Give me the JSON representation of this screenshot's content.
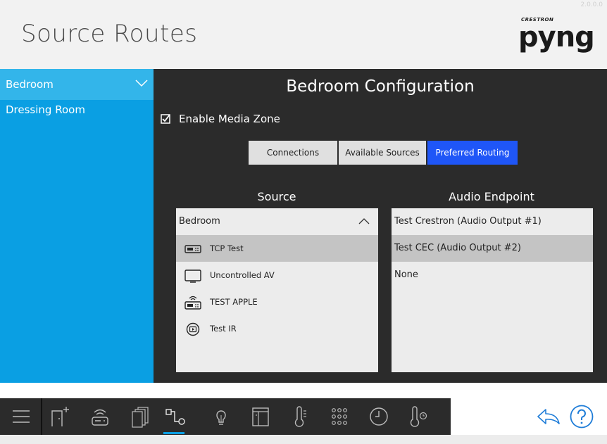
{
  "header": {
    "title": "Source Routes",
    "corner_text": "2.0.0.0"
  },
  "logo": {
    "brand": "CRESTRON",
    "word": "pyng"
  },
  "sidebar": {
    "items": [
      {
        "label": "Bedroom",
        "selected": true
      },
      {
        "label": "Dressing Room",
        "selected": false
      }
    ]
  },
  "main": {
    "title": "Bedroom Configuration",
    "enable_label": "Enable Media Zone",
    "enable_checked": true,
    "tabs": [
      {
        "label": "Connections",
        "active": false
      },
      {
        "label": "Available Sources",
        "active": false
      },
      {
        "label": "Preferred Routing",
        "active": true
      }
    ],
    "source_header": "Source",
    "endpoint_header": "Audio Endpoint",
    "source_room": "Bedroom",
    "sources": [
      {
        "label": "TCP Test",
        "icon": "set-top-box-icon",
        "selected": true
      },
      {
        "label": "Uncontrolled AV",
        "icon": "tv-icon",
        "selected": false
      },
      {
        "label": "TEST APPLE",
        "icon": "wireless-set-top-box-icon",
        "selected": false
      },
      {
        "label": "Test IR",
        "icon": "ir-player-icon",
        "selected": false
      }
    ],
    "endpoints": [
      {
        "label": "Test Crestron (Audio Output #1)",
        "selected": false
      },
      {
        "label": "Test CEC (Audio Output #2)",
        "selected": true
      },
      {
        "label": "None",
        "selected": false
      }
    ]
  },
  "colors": {
    "accent": "#0a9fe3",
    "active_tab": "#1f56f7",
    "panel_dark": "#2b2b2b"
  }
}
